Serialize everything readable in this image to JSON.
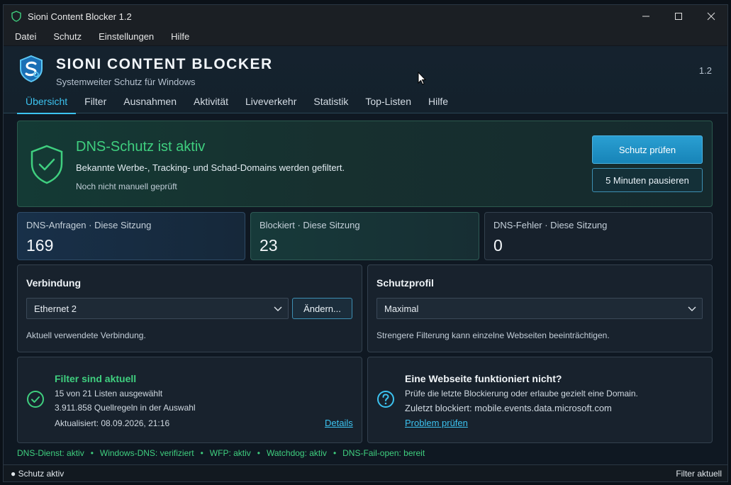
{
  "window": {
    "title": "Sioni Content Blocker 1.2"
  },
  "menu": [
    "Datei",
    "Schutz",
    "Einstellungen",
    "Hilfe"
  ],
  "header": {
    "brand": "SIONI CONTENT BLOCKER",
    "tagline": "Systemweiter Schutz für Windows",
    "version": "1.2"
  },
  "tabs": [
    "Übersicht",
    "Filter",
    "Ausnahmen",
    "Aktivität",
    "Liveverkehr",
    "Statistik",
    "Top-Listen",
    "Hilfe"
  ],
  "status": {
    "title": "DNS-Schutz ist aktiv",
    "description": "Bekannte Werbe-, Tracking- und Schad-Domains werden gefiltert.",
    "sub": "Noch nicht manuell geprüft",
    "check_button": "Schutz prüfen",
    "pause_button": "5 Minuten pausieren"
  },
  "stats": [
    {
      "label": "DNS-Anfragen · Diese Sitzung",
      "value": "169"
    },
    {
      "label": "Blockiert · Diese Sitzung",
      "value": "23"
    },
    {
      "label": "DNS-Fehler · Diese Sitzung",
      "value": "0"
    }
  ],
  "connection": {
    "title": "Verbindung",
    "selected": "Ethernet 2",
    "change_button": "Ändern...",
    "hint": "Aktuell verwendete Verbindung."
  },
  "profile": {
    "title": "Schutzprofil",
    "selected": "Maximal",
    "hint": "Strengere Filterung kann einzelne Webseiten beeinträchtigen."
  },
  "filters": {
    "title": "Filter sind aktuell",
    "line1": "15 von 21 Listen ausgewählt",
    "line2": "3.911.858 Quellregeln in der Auswahl",
    "updated": "Aktualisiert: 08.09.2026, 21:16",
    "details_link": "Details"
  },
  "help": {
    "title": "Eine Webseite funktioniert nicht?",
    "line1": "Prüfe die letzte Blockierung oder erlaube gezielt eine Domain.",
    "line2": "Zuletzt blockiert: mobile.events.data.microsoft.com",
    "link": "Problem prüfen"
  },
  "service_status": [
    "DNS-Dienst: aktiv",
    "Windows-DNS: verifiziert",
    "WFP: aktiv",
    "Watchdog: aktiv",
    "DNS-Fail-open: bereit"
  ],
  "statusbar": {
    "left": "Schutz aktiv",
    "right": "Filter aktuell"
  },
  "colors": {
    "accent": "#3cc3f0",
    "success": "#3fcf7f",
    "primary_button": "#1f8fc4"
  }
}
